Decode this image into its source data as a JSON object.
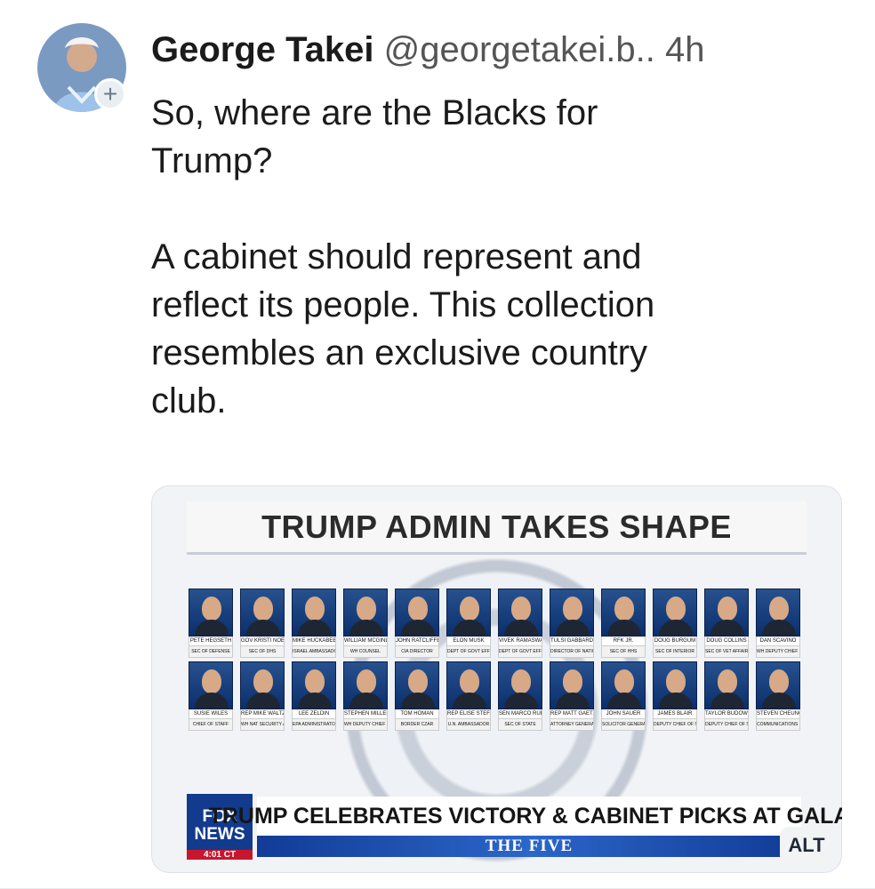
{
  "post": {
    "author": "George Takei",
    "handle": "@georgetakei.b..",
    "time": "4h",
    "follow_symbol": "+",
    "text": "So, where are the Blacks for\nTrump?\n\nA cabinet should represent and\nreflect its people. This collection\nresembles an exclusive country\nclub."
  },
  "media": {
    "banner": "TRUMP ADMIN TAKES SHAPE",
    "headline": "TRUMP CELEBRATES VICTORY & CABINET PICKS AT GALA",
    "show": "THE FIVE",
    "logo_top": "FOX",
    "logo_bottom": "NEWS",
    "logo_time": "4:01 CT",
    "alt_label": "ALT",
    "people": [
      {
        "name": "PETE HEGSETH",
        "role": "SEC OF DEFENSE"
      },
      {
        "name": "GOV KRISTI NOEM (R-SD)",
        "role": "SEC OF DHS"
      },
      {
        "name": "MIKE HUCKABEE",
        "role": "ISRAEL AMBASSADOR"
      },
      {
        "name": "WILLIAM MCGINLEY",
        "role": "WH COUNSEL"
      },
      {
        "name": "JOHN RATCLIFFE",
        "role": "CIA DIRECTOR"
      },
      {
        "name": "ELON MUSK",
        "role": "DEPT OF GOVT EFFICIENCY"
      },
      {
        "name": "VIVEK RAMASWAMY",
        "role": "DEPT OF GOVT EFFICIENCY"
      },
      {
        "name": "TULSI GABBARD",
        "role": "DIRECTOR OF NATIONAL INTEL"
      },
      {
        "name": "RFK JR.",
        "role": "SEC OF HHS"
      },
      {
        "name": "DOUG BURGUM",
        "role": "SEC OF INTERIOR"
      },
      {
        "name": "DOUG COLLINS",
        "role": "SEC OF VET AFFAIRS"
      },
      {
        "name": "DAN SCAVINO",
        "role": "WH DEPUTY CHIEF OF STAFF"
      },
      {
        "name": "SUSIE WILES",
        "role": "CHIEF OF STAFF"
      },
      {
        "name": "REP MIKE WALTZ (R-FL)",
        "role": "WH NAT SECURITY ADVISER"
      },
      {
        "name": "LEE ZELDIN",
        "role": "EPA ADMINISTRATOR"
      },
      {
        "name": "STEPHEN MILLER",
        "role": "WH DEPUTY CHIEF OF STAFF FOR POLICY"
      },
      {
        "name": "TOM HOMAN",
        "role": "BORDER CZAR"
      },
      {
        "name": "REP ELISE STEFANIK (R-NY)",
        "role": "U.N. AMBASSADOR"
      },
      {
        "name": "SEN MARCO RUBIO (R-FL)",
        "role": "SEC OF STATE"
      },
      {
        "name": "REP MATT GAETZ (R-FL)",
        "role": "ATTORNEY GENERAL"
      },
      {
        "name": "JOHN SAUER",
        "role": "SOLICITOR GENERAL"
      },
      {
        "name": "JAMES BLAIR",
        "role": "DEPUTY CHIEF OF STAFF"
      },
      {
        "name": "TAYLOR BUDOWICH",
        "role": "DEPUTY CHIEF OF STAFF"
      },
      {
        "name": "STEVEN CHEUNG",
        "role": "COMMUNICATIONS DIRECTOR"
      }
    ]
  }
}
